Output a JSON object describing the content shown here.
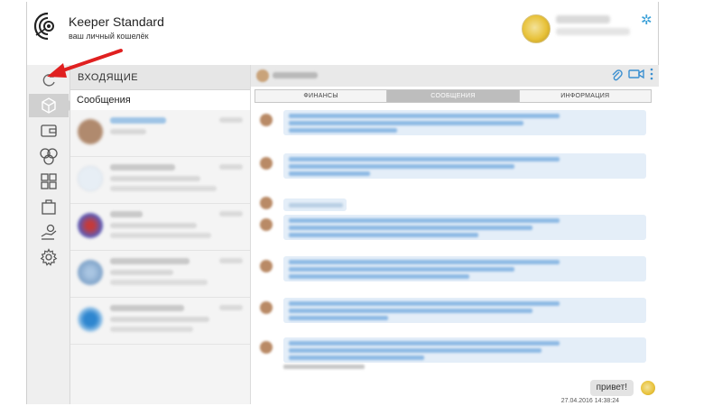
{
  "app": {
    "title": "Keeper Standard",
    "subtitle": "ваш личный кошелёк"
  },
  "inbox": {
    "header": "ВХОДЯЩИЕ",
    "subheader": "Сообщения",
    "conversations_count_visible": 5
  },
  "chat": {
    "tabs": [
      {
        "label": "ФИНАНСЫ",
        "active": false
      },
      {
        "label": "СООБЩЕНИЯ",
        "active": true
      },
      {
        "label": "ИНФОРМАЦИЯ",
        "active": false
      }
    ],
    "outgoing_message": {
      "text": "привет!",
      "timestamp": "27.04.2016 14:38:24"
    }
  },
  "sidebar_icons": [
    "refresh-icon",
    "cube-icon",
    "wallet-icon",
    "coins-icon",
    "apps-grid-icon",
    "shopping-bag-icon",
    "hand-payment-icon",
    "gear-icon"
  ],
  "colors": {
    "accent": "#3a8fd0",
    "annotation_arrow": "#e02020",
    "active_tab": "#bdbdbd",
    "bubble_incoming": "#e4eef8"
  }
}
